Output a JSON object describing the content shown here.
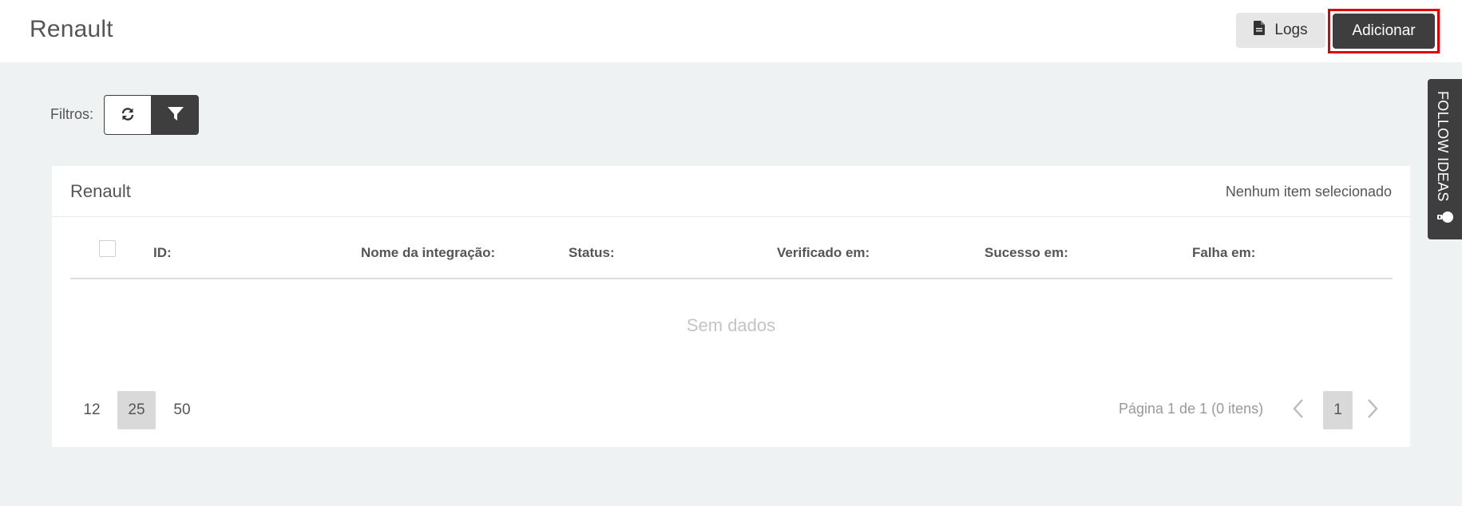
{
  "header": {
    "title": "Renault",
    "logs_label": "Logs",
    "add_label": "Adicionar"
  },
  "filters": {
    "label": "Filtros:"
  },
  "card": {
    "title": "Renault",
    "selection_status": "Nenhum item selecionado",
    "columns": [
      "ID:",
      "Nome da integração:",
      "Status:",
      "Verificado em:",
      "Sucesso em:",
      "Falha em:"
    ],
    "empty_text": "Sem dados",
    "page_sizes": [
      "12",
      "25",
      "50"
    ],
    "selected_page_size": "25",
    "paging_info": "Página 1 de 1 (0 itens)",
    "current_page": "1"
  },
  "side_tab": {
    "label": "FOLLOW IDEAS"
  },
  "icons": {
    "logs": "document-icon",
    "refresh": "refresh-icon",
    "filter": "filter-icon",
    "prev": "chevron-left-icon",
    "next": "chevron-right-icon",
    "side": "lightbulb-icon"
  },
  "colors": {
    "primary_dark": "#3e3e3e",
    "highlight": "#e30000",
    "background": "#eef2f3"
  }
}
